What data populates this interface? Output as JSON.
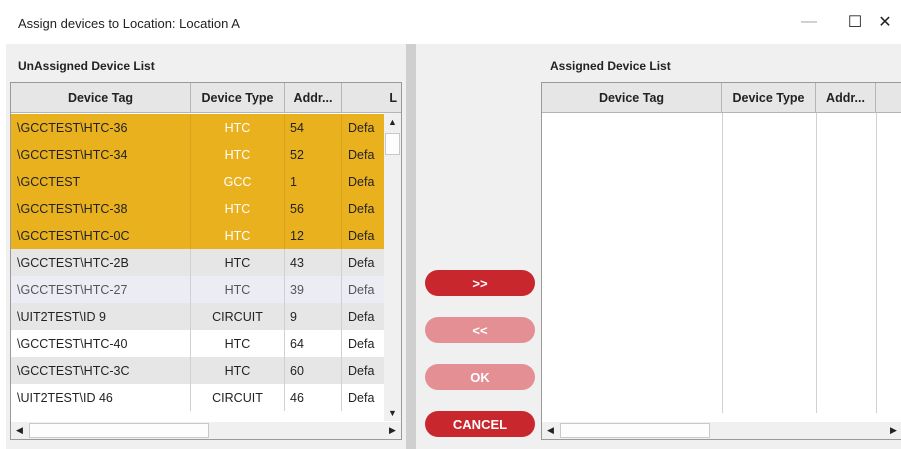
{
  "window": {
    "title": "Assign devices to Location: Location A",
    "minimize_glyph": "—",
    "maximize_glyph": "☐",
    "close_glyph": "✕"
  },
  "unassigned": {
    "label": "UnAssigned Device List",
    "columns": [
      "Device Tag",
      "Device Type",
      "Addr...",
      "L"
    ],
    "rows": [
      {
        "tag": "\\GCCTEST\\HTC-36",
        "type": "HTC",
        "addr": "54",
        "loc": "Defa",
        "state": "selected"
      },
      {
        "tag": "\\GCCTEST\\HTC-34",
        "type": "HTC",
        "addr": "52",
        "loc": "Defa",
        "state": "selected"
      },
      {
        "tag": "\\GCCTEST",
        "type": "GCC",
        "addr": "1",
        "loc": "Defa",
        "state": "selected"
      },
      {
        "tag": "\\GCCTEST\\HTC-38",
        "type": "HTC",
        "addr": "56",
        "loc": "Defa",
        "state": "selected"
      },
      {
        "tag": "\\GCCTEST\\HTC-0C",
        "type": "HTC",
        "addr": "12",
        "loc": "Defa",
        "state": "selected"
      },
      {
        "tag": "\\GCCTEST\\HTC-2B",
        "type": "HTC",
        "addr": "43",
        "loc": "Defa",
        "state": "alt"
      },
      {
        "tag": "\\GCCTEST\\HTC-27",
        "type": "HTC",
        "addr": "39",
        "loc": "Defa",
        "state": "hover"
      },
      {
        "tag": "\\UIT2TEST\\ID 9",
        "type": "CIRCUIT",
        "addr": "9",
        "loc": "Defa",
        "state": "alt"
      },
      {
        "tag": "\\GCCTEST\\HTC-40",
        "type": "HTC",
        "addr": "64",
        "loc": "Defa",
        "state": "normal"
      },
      {
        "tag": "\\GCCTEST\\HTC-3C",
        "type": "HTC",
        "addr": "60",
        "loc": "Defa",
        "state": "alt"
      },
      {
        "tag": "\\UIT2TEST\\ID 46",
        "type": "CIRCUIT",
        "addr": "46",
        "loc": "Defa",
        "state": "normal"
      }
    ]
  },
  "assigned": {
    "label": "Assigned Device List",
    "columns": [
      "Device Tag",
      "Device Type",
      "Addr...",
      ""
    ]
  },
  "buttons": {
    "assign": ">>",
    "unassign": "<<",
    "ok": "OK",
    "cancel": "CANCEL"
  },
  "scroll_glyphs": {
    "up": "▲",
    "down": "▼",
    "left": "◀",
    "right": "▶"
  },
  "colors": {
    "selected_row": "#eab11f",
    "selected_text": "#ffffff",
    "alt_row": "#e6e6e6",
    "hover_row": "#ececf4",
    "button_active": "#c9272e",
    "button_disabled": "#e38f94"
  }
}
